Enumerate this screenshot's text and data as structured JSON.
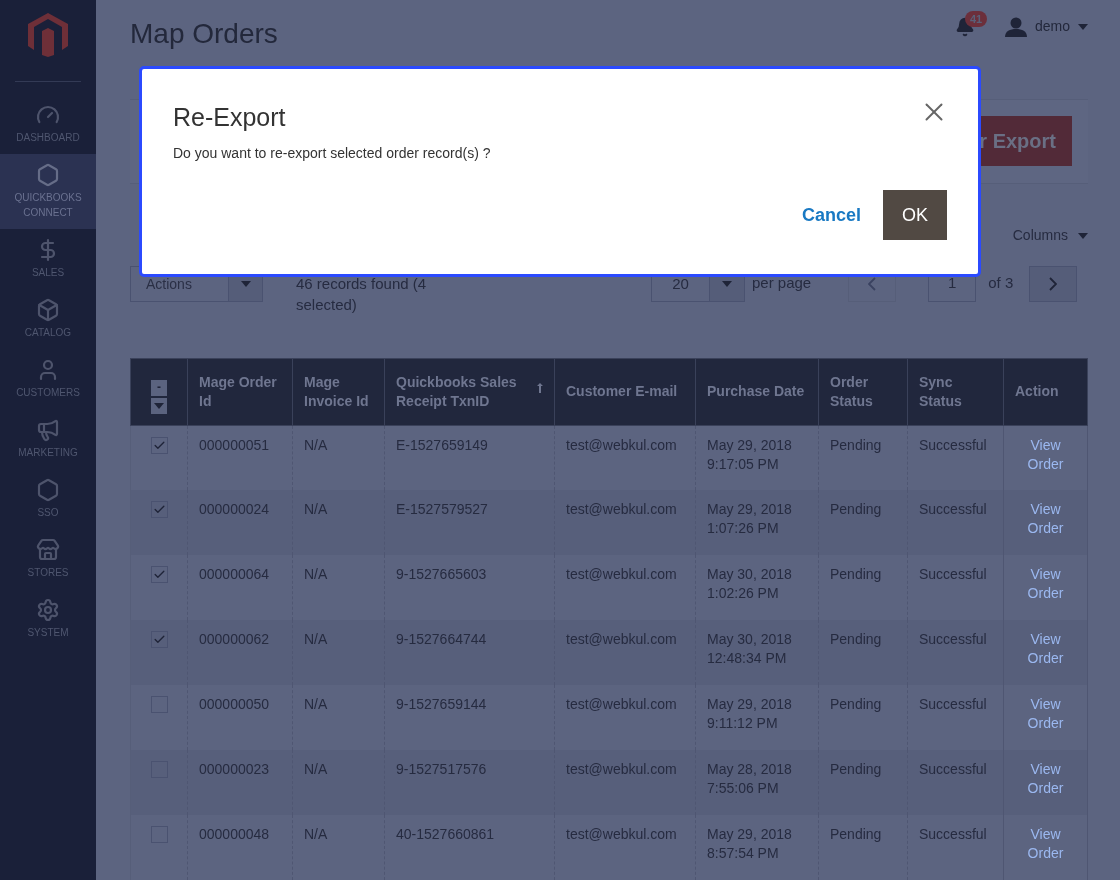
{
  "sidebar": {
    "items": [
      {
        "label": "DASHBOARD",
        "selected": false
      },
      {
        "label": "QUICKBOOKS CONNECT",
        "selected": true
      },
      {
        "label": "SALES",
        "selected": false
      },
      {
        "label": "CATALOG",
        "selected": false
      },
      {
        "label": "CUSTOMERS",
        "selected": false
      },
      {
        "label": "MARKETING",
        "selected": false
      },
      {
        "label": "SSO",
        "selected": false
      },
      {
        "label": "STORES",
        "selected": false
      },
      {
        "label": "SYSTEM",
        "selected": false
      }
    ]
  },
  "header": {
    "title": "Map Orders",
    "notification_count": "41",
    "user": "demo"
  },
  "export_button": "r Export",
  "columns_control": "Columns",
  "toolbar": {
    "actions": "Actions",
    "records": "46 records found (4 selected)",
    "per_page_value": "20",
    "per_page_label": "per page",
    "page": "1",
    "page_total": "of 3"
  },
  "table": {
    "mass_select": "-",
    "columns": [
      {
        "label": "Mage Order Id",
        "sorted": false
      },
      {
        "label": "Mage Invoice Id",
        "sorted": false
      },
      {
        "label": "Quickbooks Sales Receipt TxnID",
        "sorted": true
      },
      {
        "label": "Customer E-mail",
        "sorted": false
      },
      {
        "label": "Purchase Date",
        "sorted": false
      },
      {
        "label": "Order Status",
        "sorted": false
      },
      {
        "label": "Sync Status",
        "sorted": false
      },
      {
        "label": "Action",
        "sorted": false
      }
    ],
    "rows": [
      {
        "checked": true,
        "cells": [
          "000000051",
          "N/A",
          "E-1527659149",
          "test@webkul.com",
          "May 29, 2018 9:17:05 PM",
          "Pending",
          "Successful",
          "View Order"
        ]
      },
      {
        "checked": true,
        "cells": [
          "000000024",
          "N/A",
          "E-1527579527",
          "test@webkul.com",
          "May 29, 2018 1:07:26 PM",
          "Pending",
          "Successful",
          "View Order"
        ]
      },
      {
        "checked": true,
        "cells": [
          "000000064",
          "N/A",
          "9-1527665603",
          "test@webkul.com",
          "May 30, 2018 1:02:26 PM",
          "Pending",
          "Successful",
          "View Order"
        ]
      },
      {
        "checked": true,
        "cells": [
          "000000062",
          "N/A",
          "9-1527664744",
          "test@webkul.com",
          "May 30, 2018 12:48:34 PM",
          "Pending",
          "Successful",
          "View Order"
        ]
      },
      {
        "checked": false,
        "cells": [
          "000000050",
          "N/A",
          "9-1527659144",
          "test@webkul.com",
          "May 29, 2018 9:11:12 PM",
          "Pending",
          "Successful",
          "View Order"
        ]
      },
      {
        "checked": false,
        "cells": [
          "000000023",
          "N/A",
          "9-1527517576",
          "test@webkul.com",
          "May 28, 2018 7:55:06 PM",
          "Pending",
          "Successful",
          "View Order"
        ]
      },
      {
        "checked": false,
        "cells": [
          "000000048",
          "N/A",
          "40-1527660861",
          "test@webkul.com",
          "May 29, 2018 8:57:54 PM",
          "Pending",
          "Successful",
          "View Order"
        ]
      }
    ]
  },
  "modal": {
    "title": "Re-Export",
    "message": "Do you want to re-export selected order record(s) ?",
    "cancel": "Cancel",
    "ok": "OK"
  }
}
